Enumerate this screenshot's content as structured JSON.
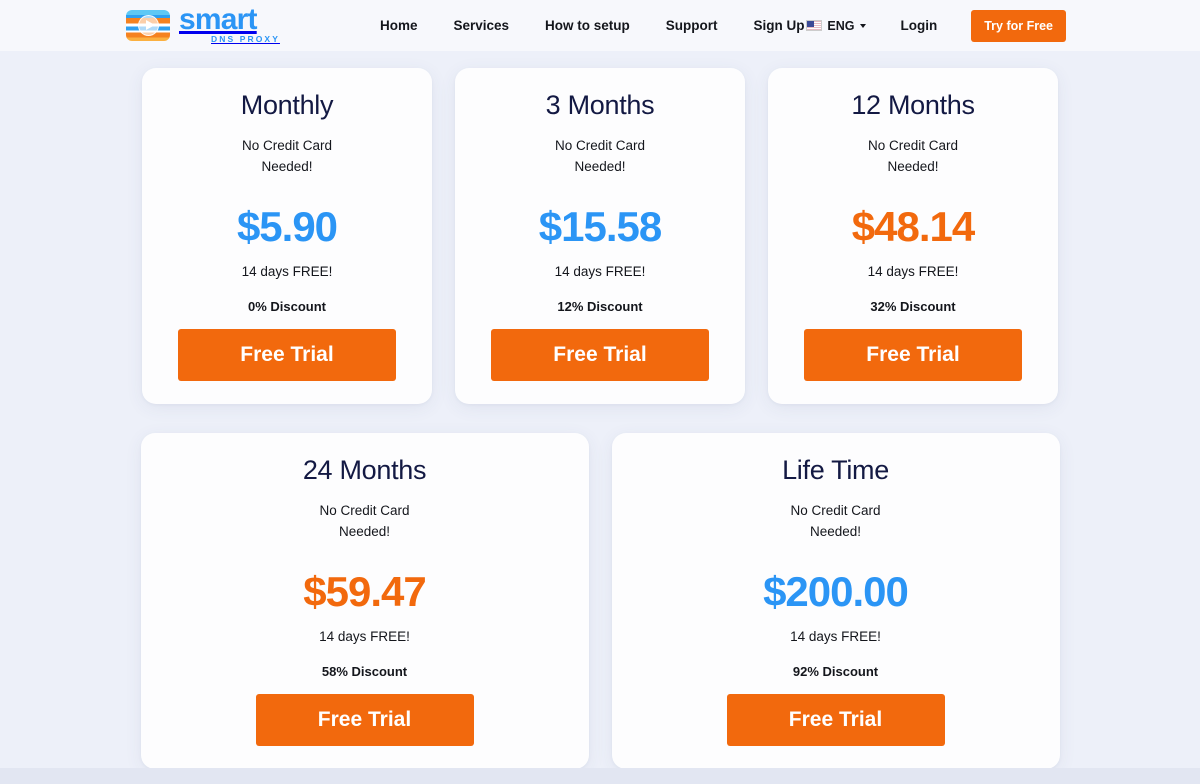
{
  "header": {
    "logo": {
      "icon": "smart-dns-proxy-logo-icon",
      "word": "smart",
      "sub": "DNS PROXY"
    },
    "nav": [
      {
        "label": "Home"
      },
      {
        "label": "Services"
      },
      {
        "label": "How to setup"
      },
      {
        "label": "Support"
      },
      {
        "label": "Sign Up"
      }
    ],
    "language": {
      "flag_icon": "us-flag-icon",
      "label": "ENG",
      "caret_icon": "chevron-down-icon"
    },
    "login_label": "Login",
    "try_label": "Try for Free"
  },
  "colors": {
    "accent_orange": "#f2690d",
    "accent_blue": "#2b95f5",
    "title_navy": "#131943",
    "page_background": "#edf0f9",
    "header_background": "#f7f8fc",
    "card_background": "#fdfdfe"
  },
  "pricing": {
    "row1": [
      {
        "title": "Monthly",
        "note": "No Credit Card\nNeeded!",
        "note_line1": "No Credit Card",
        "note_line2": "Needed!",
        "price": "$5.90",
        "price_color": "blue",
        "free": "14 days FREE!",
        "discount": "0% Discount",
        "cta": "Free Trial"
      },
      {
        "title": "3 Months",
        "note_line1": "No Credit Card",
        "note_line2": "Needed!",
        "price": "$15.58",
        "price_color": "blue",
        "free": "14 days FREE!",
        "discount": "12% Discount",
        "cta": "Free Trial"
      },
      {
        "title": "12 Months",
        "note_line1": "No Credit Card",
        "note_line2": "Needed!",
        "price": "$48.14",
        "price_color": "orange",
        "free": "14 days FREE!",
        "discount": "32% Discount",
        "cta": "Free Trial"
      }
    ],
    "row2": [
      {
        "title": "24 Months",
        "note_line1": "No Credit Card",
        "note_line2": "Needed!",
        "price": "$59.47",
        "price_color": "orange",
        "free": "14 days FREE!",
        "discount": "58% Discount",
        "cta": "Free Trial"
      },
      {
        "title": "Life Time",
        "note_line1": "No Credit Card",
        "note_line2": "Needed!",
        "price": "$200.00",
        "price_color": "blue",
        "free": "14 days FREE!",
        "discount": "92% Discount",
        "cta": "Free Trial"
      }
    ]
  }
}
